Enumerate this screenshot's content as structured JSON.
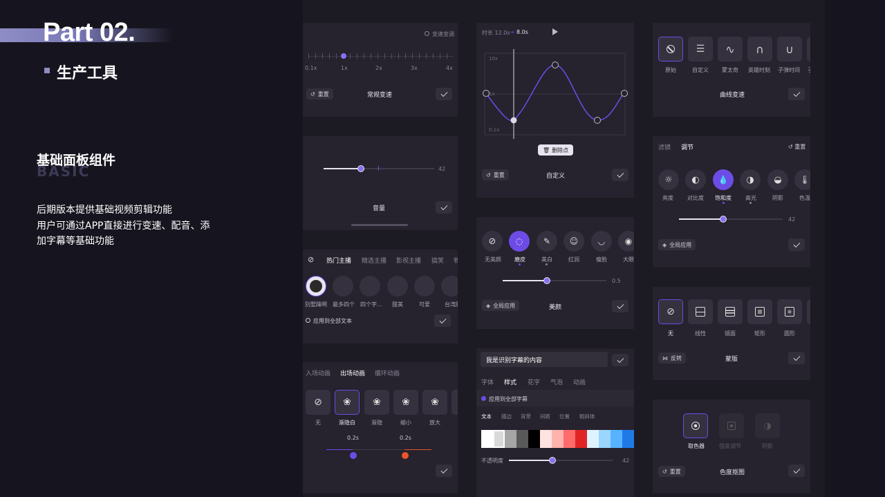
{
  "header": {
    "part": "Part 02.",
    "subtitle": "生产工具"
  },
  "section": {
    "title": "基础面板组件",
    "ghost": "BASIC",
    "desc1": "后期版本提供基础视频剪辑功能",
    "desc2": "用户可通过APP直接进行变速、配音、添",
    "desc3": "加字幕等基础功能"
  },
  "speed": {
    "toggle": "变速变调",
    "ticks": [
      "0.1x",
      "1x",
      "2x",
      "3x",
      "4x"
    ],
    "reset": "重置",
    "title": "常规变速"
  },
  "curve": {
    "duration": "时长 12.0s",
    "result": "8.0s",
    "ymax": "10x",
    "ymid": "1x",
    "ymin": "0.1x",
    "delete": "删除点",
    "reset": "重置",
    "title": "自定义"
  },
  "curvePresets": {
    "items": [
      "原始",
      "自定义",
      "蒙太奇",
      "英雄时刻",
      "子弹时间",
      "子"
    ],
    "title": "曲线变速"
  },
  "volume": {
    "value": "42",
    "title": "音量"
  },
  "adjust": {
    "tabs": [
      "滤镜",
      "调节"
    ],
    "reset": "重置",
    "items": [
      "亮度",
      "对比度",
      "饱和度",
      "高光",
      "阴影",
      "色温"
    ],
    "value": "42",
    "apply": "全局应用"
  },
  "beauty": {
    "items": [
      "无美颜",
      "磨皮",
      "美白",
      "红润",
      "瘦脸",
      "大眼"
    ],
    "value": "0.5",
    "apply": "全局应用",
    "title": "美颜"
  },
  "anchor": {
    "tabs": [
      "热门主播",
      "精选主播",
      "影视主播",
      "搞笑",
      "物"
    ],
    "names": [
      "别墅躁啊",
      "最多四个",
      "四个字...",
      "甜美",
      "可爱",
      "台湾腔"
    ],
    "apply": "应用到全部文本"
  },
  "mask": {
    "items": [
      "无",
      "线性",
      "镜面",
      "矩形",
      "圆形"
    ],
    "invert": "反转",
    "title": "蒙版"
  },
  "anim": {
    "tabs": [
      "入场动画",
      "出场动画",
      "循环动画"
    ],
    "items": [
      "无",
      "渐隐白",
      "渐隐",
      "缩小",
      "放大"
    ],
    "t1": "0.2s",
    "t2": "0.2s"
  },
  "subtitle": {
    "text": "我是识别字幕的内容",
    "tabs": [
      "字体",
      "样式",
      "花字",
      "气泡",
      "动画"
    ],
    "apply": "应用到全部字幕",
    "subtabs": [
      "文本",
      "描边",
      "背景",
      "间距",
      "位置",
      "粗斜体"
    ],
    "swatches": [
      "#ffffff",
      "#d9d9d9",
      "#a6a6a6",
      "#595959",
      "#000000",
      "#ffe3e0",
      "#ffb3ad",
      "#ff6b6b",
      "#e02424",
      "#dff3ff",
      "#9ad6ff",
      "#57b3ff",
      "#1f7ae8"
    ],
    "opacity": "不透明度",
    "value": "42"
  },
  "chroma": {
    "items": [
      "取色器",
      "强度调节",
      "阴影"
    ],
    "reset": "重置",
    "title": "色度抠图"
  },
  "colors": {
    "accent": "#6d4ce6",
    "orange": "#e8552a"
  }
}
